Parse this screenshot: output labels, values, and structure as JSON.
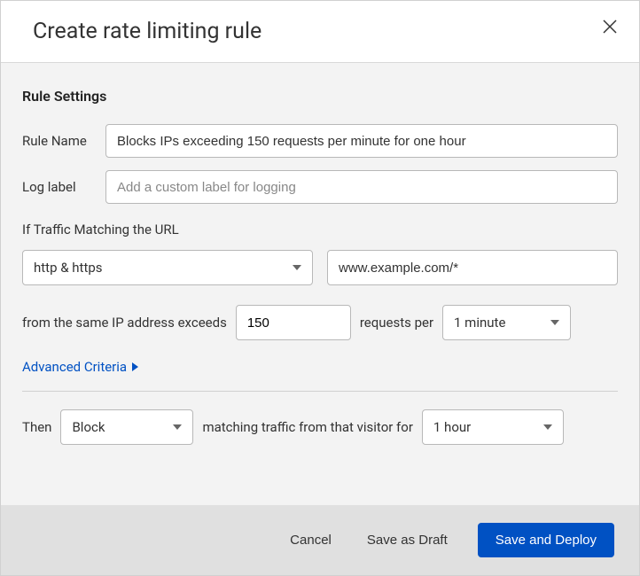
{
  "header": {
    "title": "Create rate limiting rule"
  },
  "settings": {
    "section_title": "Rule Settings",
    "rule_name_label": "Rule Name",
    "rule_name_value": "Blocks IPs exceeding 150 requests per minute for one hour",
    "log_label_label": "Log label",
    "log_label_placeholder": "Add a custom label for logging",
    "traffic_label": "If Traffic Matching the URL",
    "scheme_value": "http & https",
    "url_value": "www.example.com/*",
    "ip_prefix": "from the same IP address exceeds",
    "threshold_value": "150",
    "requests_per": "requests per",
    "period_value": "1 minute",
    "advanced_label": "Advanced Criteria",
    "then_label": "Then",
    "action_value": "Block",
    "matching_text": "matching traffic from that visitor for",
    "duration_value": "1 hour"
  },
  "footer": {
    "cancel": "Cancel",
    "draft": "Save as Draft",
    "deploy": "Save and Deploy"
  }
}
